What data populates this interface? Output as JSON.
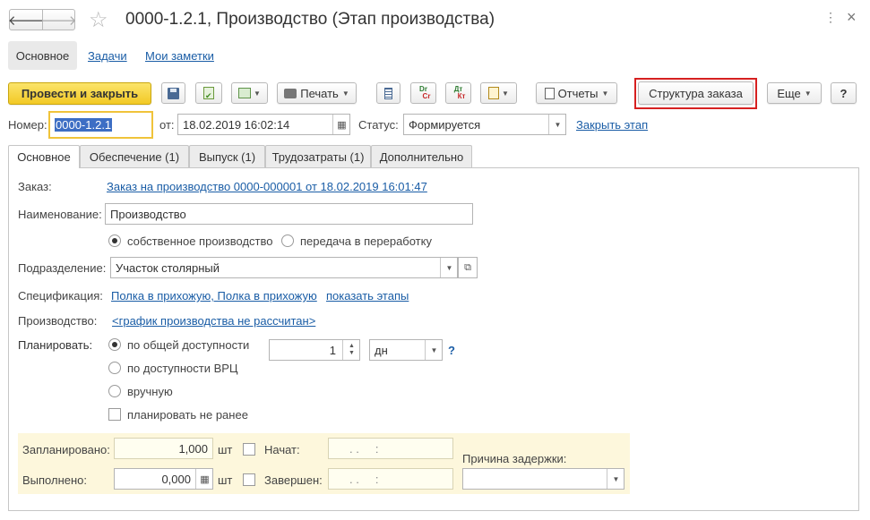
{
  "window": {
    "title": "0000-1.2.1, Производство (Этап производства)"
  },
  "nav_tabs": {
    "main": "Основное",
    "tasks": "Задачи",
    "notes": "Мои заметки"
  },
  "toolbar": {
    "post_close": "Провести и закрыть",
    "print": "Печать",
    "dr_cr_top": "Dr",
    "dr_cr_bottom": "Cr",
    "dt_kt_top": "Дт",
    "dt_kt_bottom": "Кт",
    "reports": "Отчеты",
    "order_structure": "Структура заказа",
    "more": "Еще",
    "help": "?"
  },
  "header": {
    "number_label": "Номер:",
    "number_value": "0000-1.2.1",
    "date_label": "от:",
    "date_value": "18.02.2019 16:02:14",
    "status_label": "Статус:",
    "status_value": "Формируется",
    "close_stage": "Закрыть этап"
  },
  "tabs": [
    "Основное",
    "Обеспечение (1)",
    "Выпуск (1)",
    "Трудозатраты (1)",
    "Дополнительно"
  ],
  "form": {
    "order_label": "Заказ:",
    "order_link": "Заказ на производство 0000-000001 от 18.02.2019 16:01:47",
    "name_label": "Наименование:",
    "name_value": "Производство",
    "own_production": "собственное производство",
    "outsourcing": "передача в переработку",
    "division_label": "Подразделение:",
    "division_value": "Участок столярный",
    "spec_label": "Спецификация:",
    "spec_link": "Полка в прихожую, Полка в прихожую",
    "show_stages": "показать этапы",
    "production_label": "Производство:",
    "production_link": "<график производства не рассчитан>",
    "plan_label": "Планировать:",
    "plan_general": "по общей доступности",
    "plan_wc": "по доступности ВРЦ",
    "plan_manual": "вручную",
    "plan_not_earlier": "планировать не ранее",
    "duration_value": "1",
    "unit_value": "дн",
    "unit_help": "?"
  },
  "footer": {
    "planned_label": "Запланировано:",
    "planned_value": "1,000",
    "planned_unit": "шт",
    "done_label": "Выполнено:",
    "done_value": "0,000",
    "done_unit": "шт",
    "started_label": "Начат:",
    "started_value": ". .     :",
    "finished_label": "Завершен:",
    "finished_value": ". .     :",
    "delay_label": "Причина задержки:",
    "delay_value": ""
  },
  "colors": {
    "primary_button": "#f5d33b",
    "link": "#1a5da6",
    "highlight_border": "#d62020",
    "footer_bg": "#fdf7dc"
  }
}
